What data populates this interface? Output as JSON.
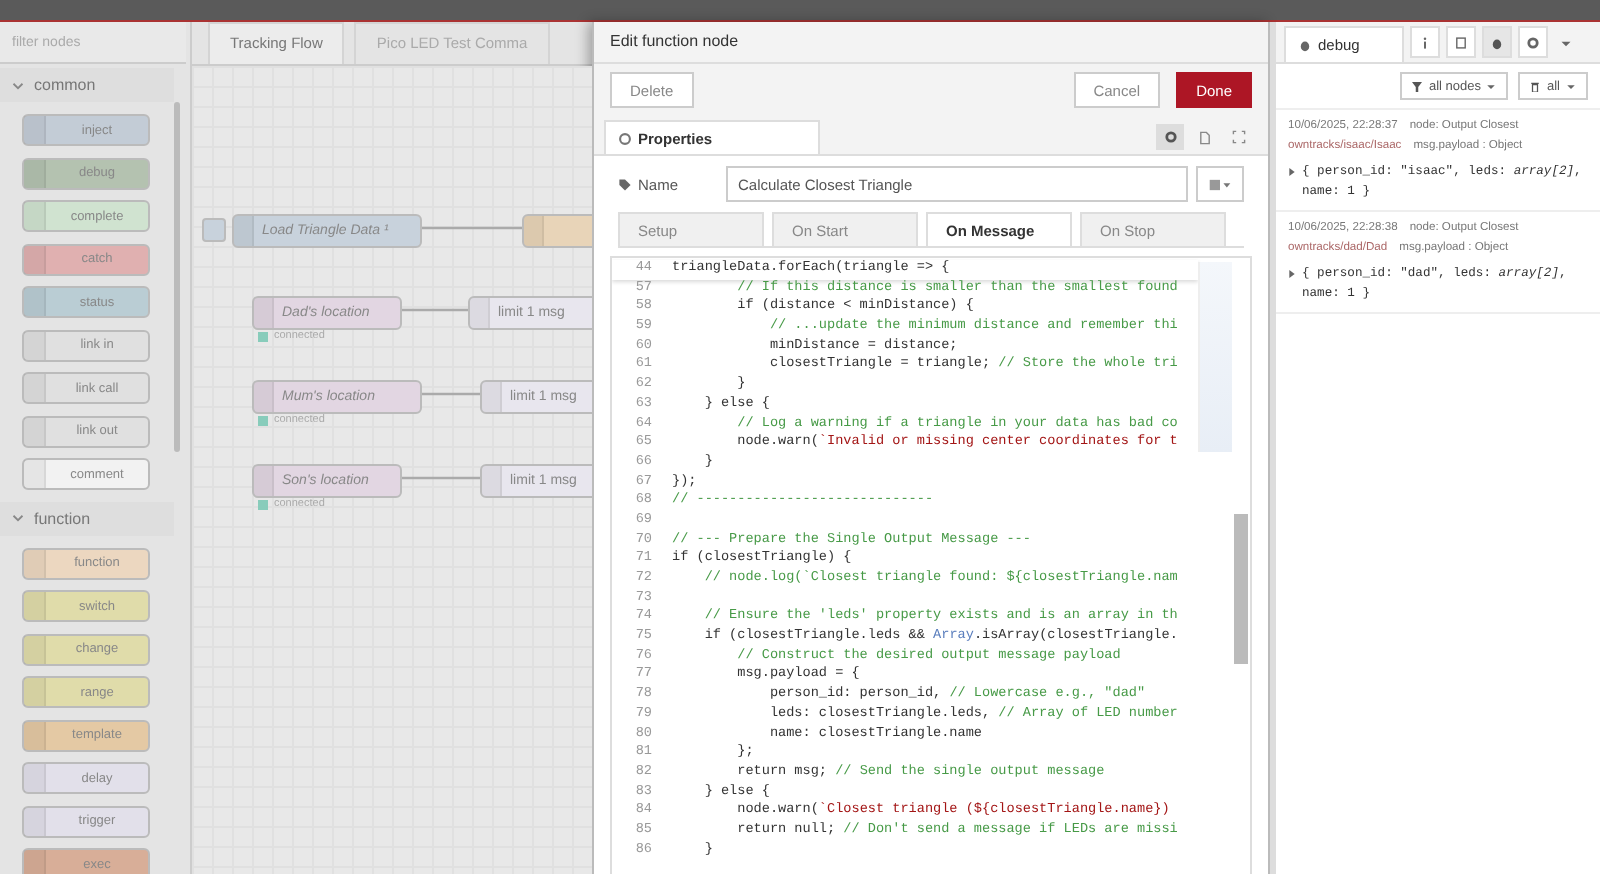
{
  "palette": {
    "search": {
      "placeholder": "filter nodes"
    },
    "categories": [
      {
        "name": "common",
        "expanded": true,
        "nodes": [
          {
            "label": "inject",
            "color": "#c3ccd6"
          },
          {
            "label": "debug",
            "color": "#b4c2b0"
          },
          {
            "label": "complete",
            "color": "#d0e3d0"
          },
          {
            "label": "catch",
            "color": "#e0b0b0"
          },
          {
            "label": "status",
            "color": "#bacdd4"
          },
          {
            "label": "link in",
            "color": "#e0e0e0"
          },
          {
            "label": "link call",
            "color": "#e0e0e0"
          },
          {
            "label": "link out",
            "color": "#e0e0e0"
          },
          {
            "label": "comment",
            "color": "#f2f2f2"
          }
        ]
      },
      {
        "name": "function",
        "expanded": true,
        "nodes": [
          {
            "label": "function",
            "color": "#ecd7c0"
          },
          {
            "label": "switch",
            "color": "#e0dcaa"
          },
          {
            "label": "change",
            "color": "#e0dcaa"
          },
          {
            "label": "range",
            "color": "#e0dcaa"
          },
          {
            "label": "template",
            "color": "#e4c9a4"
          },
          {
            "label": "delay",
            "color": "#e2e0ea"
          },
          {
            "label": "trigger",
            "color": "#e2e0ea"
          },
          {
            "label": "exec",
            "color": "#d8ae98"
          }
        ]
      }
    ]
  },
  "workspace": {
    "tabs": [
      {
        "label": "Tracking Flow",
        "selected": true
      },
      {
        "label": "Pico LED Test Comma",
        "selected": false
      }
    ],
    "nodes": [
      {
        "kind": "inject",
        "label": "Load Triangle Data ¹"
      },
      {
        "kind": "file"
      },
      {
        "kind": "mqtt",
        "label": "Dad's location",
        "status": "connected"
      },
      {
        "kind": "limit",
        "label": "limit 1 msg"
      },
      {
        "kind": "mqtt",
        "label": "Mum's location",
        "status": "connected"
      },
      {
        "kind": "limit",
        "label": "limit 1 msg"
      },
      {
        "kind": "mqtt",
        "label": "Son's location",
        "status": "connected"
      },
      {
        "kind": "limit",
        "label": "limit 1 msg"
      }
    ]
  },
  "tray": {
    "title": "Edit function node",
    "delete": "Delete",
    "cancel": "Cancel",
    "done": "Done",
    "section": "Properties",
    "name_label": "Name",
    "name_value": "Calculate Closest Triangle",
    "tabs": [
      {
        "label": "Setup",
        "selected": false
      },
      {
        "label": "On Start",
        "selected": false
      },
      {
        "label": "On Message",
        "selected": true
      },
      {
        "label": "On Stop",
        "selected": false
      }
    ],
    "code": [
      {
        "n": "44",
        "parts": [
          {
            "kind": "plain",
            "t": "triangleData.forEach(triangle => {"
          }
        ]
      },
      {
        "n": "57",
        "parts": [
          {
            "kind": "comment",
            "t": "        // If this distance is smaller than the smallest found"
          }
        ]
      },
      {
        "n": "58",
        "parts": [
          {
            "kind": "plain",
            "t": "        if (distance < minDistance) {"
          }
        ]
      },
      {
        "n": "59",
        "parts": [
          {
            "kind": "comment",
            "t": "            // ...update the minimum distance and remember thi"
          }
        ]
      },
      {
        "n": "60",
        "parts": [
          {
            "kind": "plain",
            "t": "            minDistance = distance;"
          }
        ]
      },
      {
        "n": "61",
        "parts": [
          {
            "kind": "plain",
            "t": "            closestTriangle = triangle; "
          },
          {
            "kind": "comment",
            "t": "// Store the whole tri"
          }
        ]
      },
      {
        "n": "62",
        "parts": [
          {
            "kind": "plain",
            "t": "        }"
          }
        ]
      },
      {
        "n": "63",
        "parts": [
          {
            "kind": "plain",
            "t": "    } else {"
          }
        ]
      },
      {
        "n": "64",
        "parts": [
          {
            "kind": "comment",
            "t": "        // Log a warning if a triangle in your data has bad co"
          }
        ]
      },
      {
        "n": "65",
        "parts": [
          {
            "kind": "plain",
            "t": "        node.warn("
          },
          {
            "kind": "string",
            "t": "`Invalid or missing center coordinates for t"
          }
        ]
      },
      {
        "n": "66",
        "parts": [
          {
            "kind": "plain",
            "t": "    }"
          }
        ]
      },
      {
        "n": "67",
        "parts": [
          {
            "kind": "plain",
            "t": "});"
          }
        ]
      },
      {
        "n": "68",
        "parts": [
          {
            "kind": "comment",
            "t": "// -----------------------------"
          }
        ]
      },
      {
        "n": "69"
      },
      {
        "n": "70",
        "parts": [
          {
            "kind": "comment",
            "t": "// --- Prepare the Single Output Message ---"
          }
        ]
      },
      {
        "n": "71",
        "parts": [
          {
            "kind": "plain",
            "t": "if (closestTriangle) {"
          }
        ]
      },
      {
        "n": "72",
        "parts": [
          {
            "kind": "comment",
            "t": "    // node.log(`Closest triangle found: ${closestTriangle.nam"
          }
        ]
      },
      {
        "n": "73"
      },
      {
        "n": "74",
        "parts": [
          {
            "kind": "comment",
            "t": "    // Ensure the 'leds' property exists and is an array in th"
          }
        ]
      },
      {
        "n": "75",
        "parts": [
          {
            "kind": "plain",
            "t": "    if (closestTriangle.leds && "
          },
          {
            "kind": "builtin",
            "t": "Array"
          },
          {
            "kind": "plain",
            "t": ".isArray(closestTriangle."
          }
        ]
      },
      {
        "n": "76",
        "parts": [
          {
            "kind": "comment",
            "t": "        // Construct the desired output message payload"
          }
        ]
      },
      {
        "n": "77",
        "parts": [
          {
            "kind": "plain",
            "t": "        msg.payload = {"
          }
        ]
      },
      {
        "n": "78",
        "parts": [
          {
            "kind": "plain",
            "t": "            person_id: person_id, "
          },
          {
            "kind": "comment",
            "t": "// Lowercase e.g., \"dad\""
          }
        ]
      },
      {
        "n": "79",
        "parts": [
          {
            "kind": "plain",
            "t": "            leds: closestTriangle.leds, "
          },
          {
            "kind": "comment",
            "t": "// Array of LED number"
          }
        ]
      },
      {
        "n": "80",
        "parts": [
          {
            "kind": "plain",
            "t": "            name: closestTriangle.name"
          }
        ]
      },
      {
        "n": "81",
        "parts": [
          {
            "kind": "plain",
            "t": "        };"
          }
        ]
      },
      {
        "n": "82",
        "parts": [
          {
            "kind": "plain",
            "t": "        return msg; "
          },
          {
            "kind": "comment",
            "t": "// Send the single output message"
          }
        ]
      },
      {
        "n": "83",
        "parts": [
          {
            "kind": "plain",
            "t": "    } else {"
          }
        ]
      },
      {
        "n": "84",
        "parts": [
          {
            "kind": "plain",
            "t": "        node.warn("
          },
          {
            "kind": "string",
            "t": "`Closest triangle (${closestTriangle.name}) "
          }
        ]
      },
      {
        "n": "85",
        "parts": [
          {
            "kind": "plain",
            "t": "        return null; "
          },
          {
            "kind": "comment",
            "t": "// Don't send a message if LEDs are missi"
          }
        ]
      },
      {
        "n": "86",
        "parts": [
          {
            "kind": "plain",
            "t": "    }"
          }
        ]
      }
    ]
  },
  "sidebar": {
    "tab": "debug",
    "filter": "all nodes",
    "clear": "all",
    "messages": [
      {
        "time": "10/06/2025, 22:28:37",
        "node": "node: Output Closest",
        "topic": "owntracks/isaac/Isaac",
        "type": "msg.payload : Object",
        "payload": "{ person_id: \"isaac\", leds: *array[2]*, name: 1 }"
      },
      {
        "time": "10/06/2025, 22:28:38",
        "node": "node: Output Closest",
        "topic": "owntracks/dad/Dad",
        "type": "msg.payload : Object",
        "payload": "{ person_id: \"dad\", leds: *array[2]*, name: 1 }"
      }
    ]
  }
}
